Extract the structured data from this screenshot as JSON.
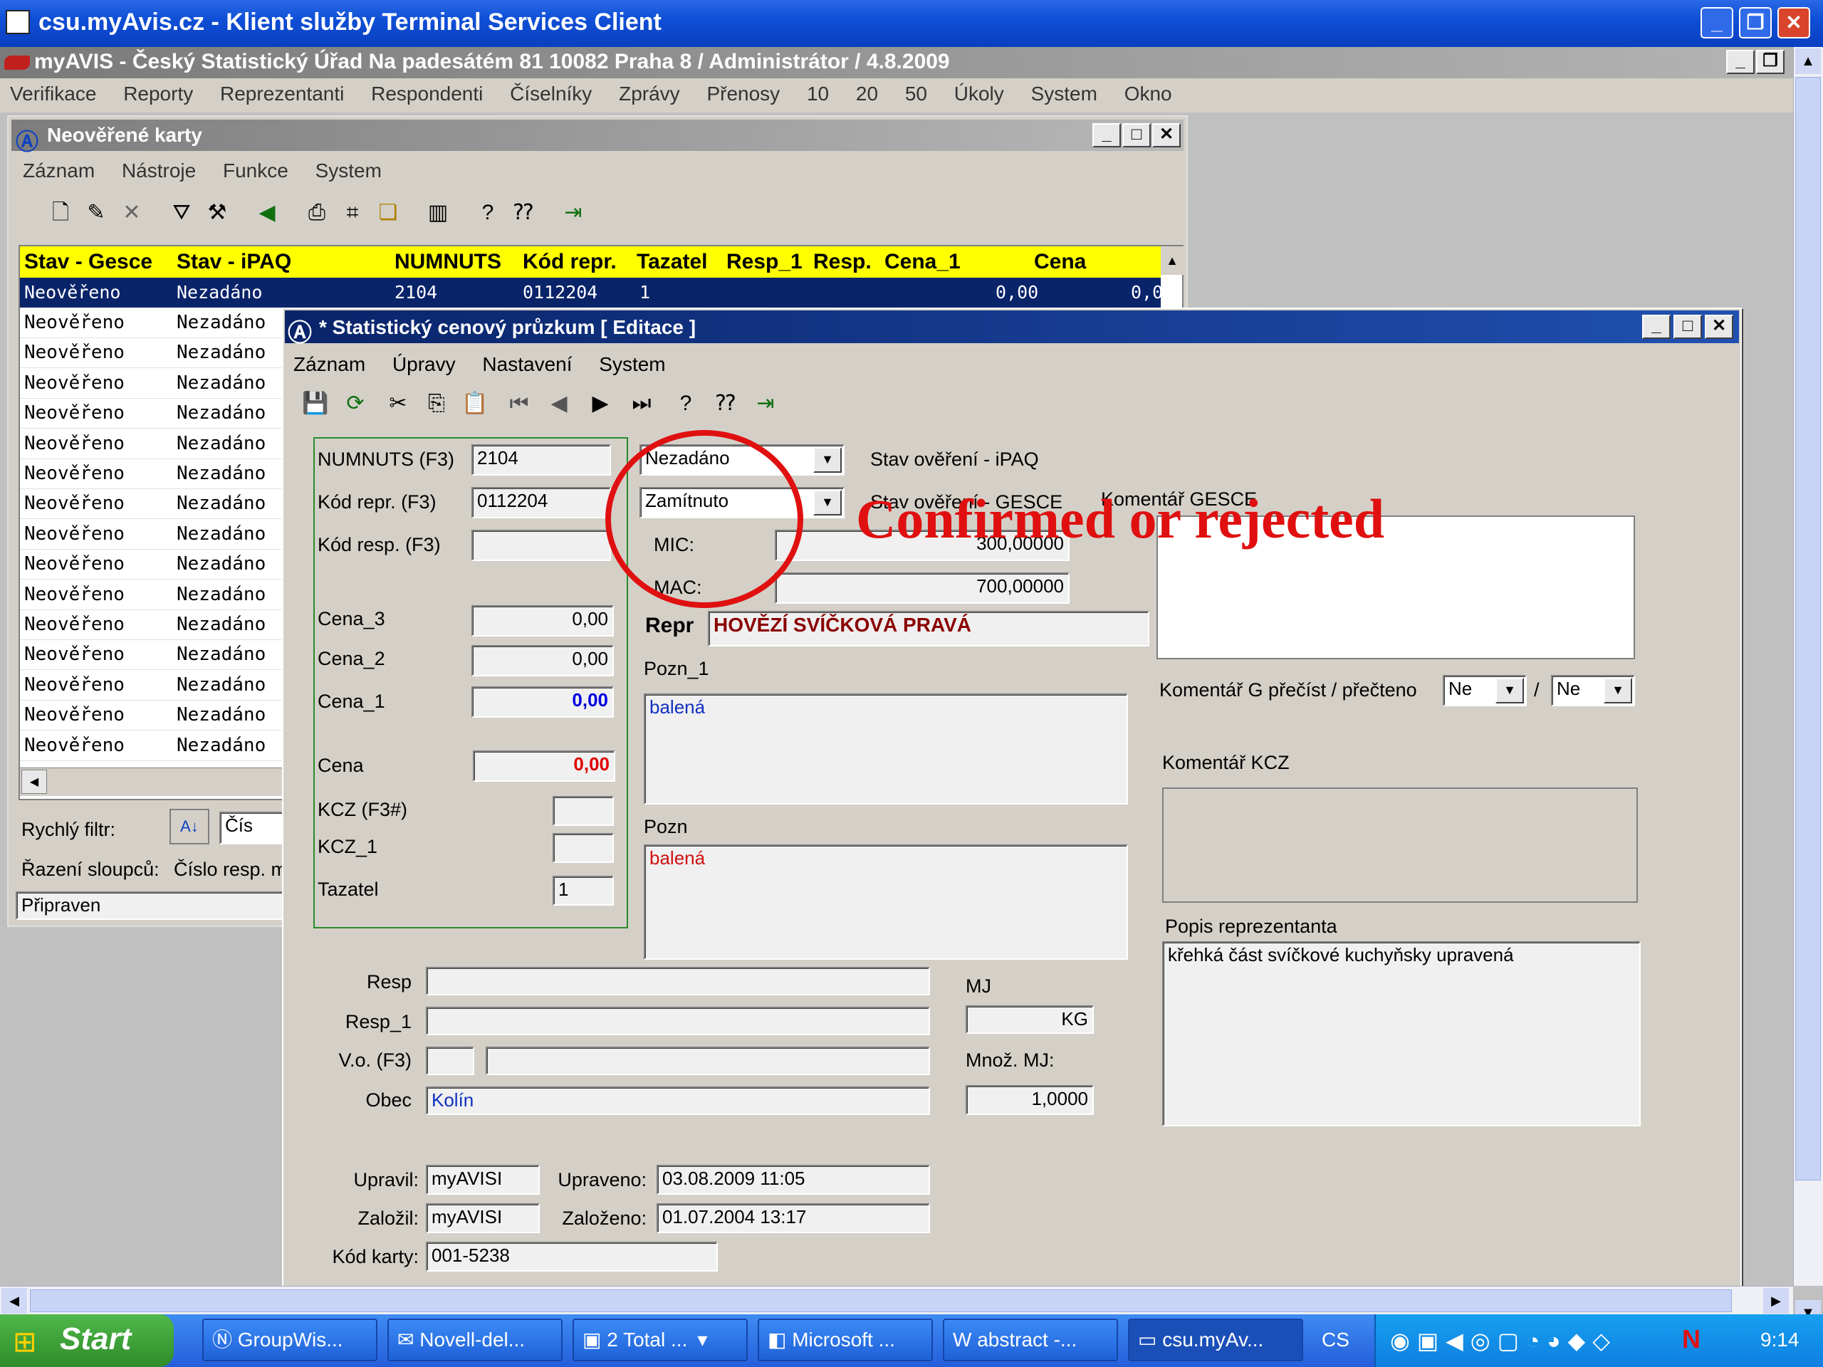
{
  "outer_window": {
    "title": "csu.myAvis.cz - Klient služby Terminal Services Client"
  },
  "app": {
    "title": "myAVIS - Český Statistický Úřad Na padesátém 81 10082 Praha 8 / Administrátor / 4.8.2009",
    "menu": [
      "Verifikace",
      "Reporty",
      "Reprezentanti",
      "Respondenti",
      "Číselníky",
      "Zprávy",
      "Přenosy",
      "10",
      "20",
      "50",
      "Úkoly",
      "System",
      "Okno"
    ]
  },
  "list_window": {
    "title": "Neověřené karty",
    "menu": [
      "Záznam",
      "Nástroje",
      "Funkce",
      "System"
    ],
    "columns": [
      "Stav - Gesce",
      "Stav - iPAQ",
      "NUMNUTS",
      "Kód repr.",
      "Tazatel",
      "Resp_1",
      "Resp.",
      "Cena_1",
      "Cena"
    ],
    "selected_row": {
      "stav_gesce": "Neověřeno",
      "stav_ipaq": "Nezadáno",
      "numnuts": "2104",
      "kod_repr": "0112204",
      "tazatel": "1",
      "cena_1": "0,00",
      "cena": "0,0"
    },
    "rows": [
      [
        "Neověřeno",
        "Nezadáno"
      ],
      [
        "Neověřeno",
        "Nezadáno"
      ],
      [
        "Neověřeno",
        "Nezadáno"
      ],
      [
        "Neověřeno",
        "Nezadáno"
      ],
      [
        "Neověřeno",
        "Nezadáno"
      ],
      [
        "Neověřeno",
        "Nezadáno"
      ],
      [
        "Neověřeno",
        "Nezadáno"
      ],
      [
        "Neověřeno",
        "Nezadáno"
      ],
      [
        "Neověřeno",
        "Nezadáno"
      ],
      [
        "Neověřeno",
        "Nezadáno"
      ],
      [
        "Neověřeno",
        "Nezadáno"
      ],
      [
        "Neověřeno",
        "Nezadáno"
      ],
      [
        "Neověřeno",
        "Nezadáno"
      ],
      [
        "Neověřeno",
        "Nezadáno"
      ],
      [
        "Neověřeno",
        "Nezadáno"
      ]
    ],
    "quick_filter_label": "Rychlý filtr:",
    "quick_filter_value": "Čís",
    "sort_label": "Řazení sloupců:",
    "sort_value": "Číslo resp. m",
    "status": "Připraven"
  },
  "edit_window": {
    "title": "* Statistický cenový průzkum  [ Editace ]",
    "menu": [
      "Záznam",
      "Úpravy",
      "Nastavení",
      "System"
    ],
    "fields": {
      "numnuts_label": "NUMNUTS (F3)",
      "numnuts": "2104",
      "kod_repr_label": "Kód repr. (F3)",
      "kod_repr": "0112204",
      "kod_resp_label": "Kód resp. (F3)",
      "kod_resp": "",
      "cena3_label": "Cena_3",
      "cena3": "0,00",
      "cena2_label": "Cena_2",
      "cena2": "0,00",
      "cena1_label": "Cena_1",
      "cena1": "0,00",
      "cena_label": "Cena",
      "cena": "0,00",
      "kcz_label": "KCZ (F3#)",
      "kcz": "",
      "kcz1_label": "KCZ_1",
      "kcz1": "",
      "tazatel_label": "Tazatel",
      "tazatel": "1",
      "stav_ipaq": "Nezadáno",
      "stav_ipaq_label": "Stav ověření - iPAQ",
      "stav_gesce": "Zamítnuto",
      "stav_gesce_label": "Stav ověření - GESCE",
      "mic_label": "MIC:",
      "mic": "300,00000",
      "mac_label": "MAC:",
      "mac": "700,00000",
      "repr_label": "Repr",
      "repr": "HOVĚZÍ SVÍČKOVÁ PRAVÁ",
      "pozn1_label": "Pozn_1",
      "pozn1": "balená",
      "pozn_label": "Pozn",
      "pozn": "balená",
      "komentar_gesce_label": "Komentář GESCE",
      "komentar_g_label": "Komentář G přečíst / přečteno",
      "komentar_g1": "Ne",
      "komentar_g2": "Ne",
      "slash": "/",
      "komentar_kcz_label": "Komentář KCZ",
      "popis_label": "Popis reprezentanta",
      "popis": "křehká část svíčkové kuchyňsky upravená",
      "resp_label": "Resp",
      "resp": "",
      "resp1_label": "Resp_1",
      "resp1": "",
      "vo_label": "V.o. (F3)",
      "obec_label": "Obec",
      "obec": "Kolín",
      "mj_label": "MJ",
      "mj": "KG",
      "mnoz_label": "Množ. MJ:",
      "mnoz": "1,0000",
      "upravil_label": "Upravil:",
      "upravil": "myAVISI",
      "upraveno_label": "Upraveno:",
      "upraveno": "03.08.2009 11:05",
      "zalozil_label": "Založil:",
      "zalozil": "myAVISI",
      "zalozeno_label": "Založeno:",
      "zalozeno": "01.07.2004 13:17",
      "kod_karty_label": "Kód karty:",
      "kod_karty": "001-5238"
    },
    "annotation": "Confirmed or rejected",
    "annotation_color": "#e01010"
  },
  "taskbar": {
    "start": "Start",
    "items": [
      "GroupWis...",
      "Novell-del...",
      "2 Total ...",
      "Microsoft ...",
      "abstract -...",
      "csu.myAv..."
    ],
    "lang": "CS",
    "clock": "9:14"
  }
}
